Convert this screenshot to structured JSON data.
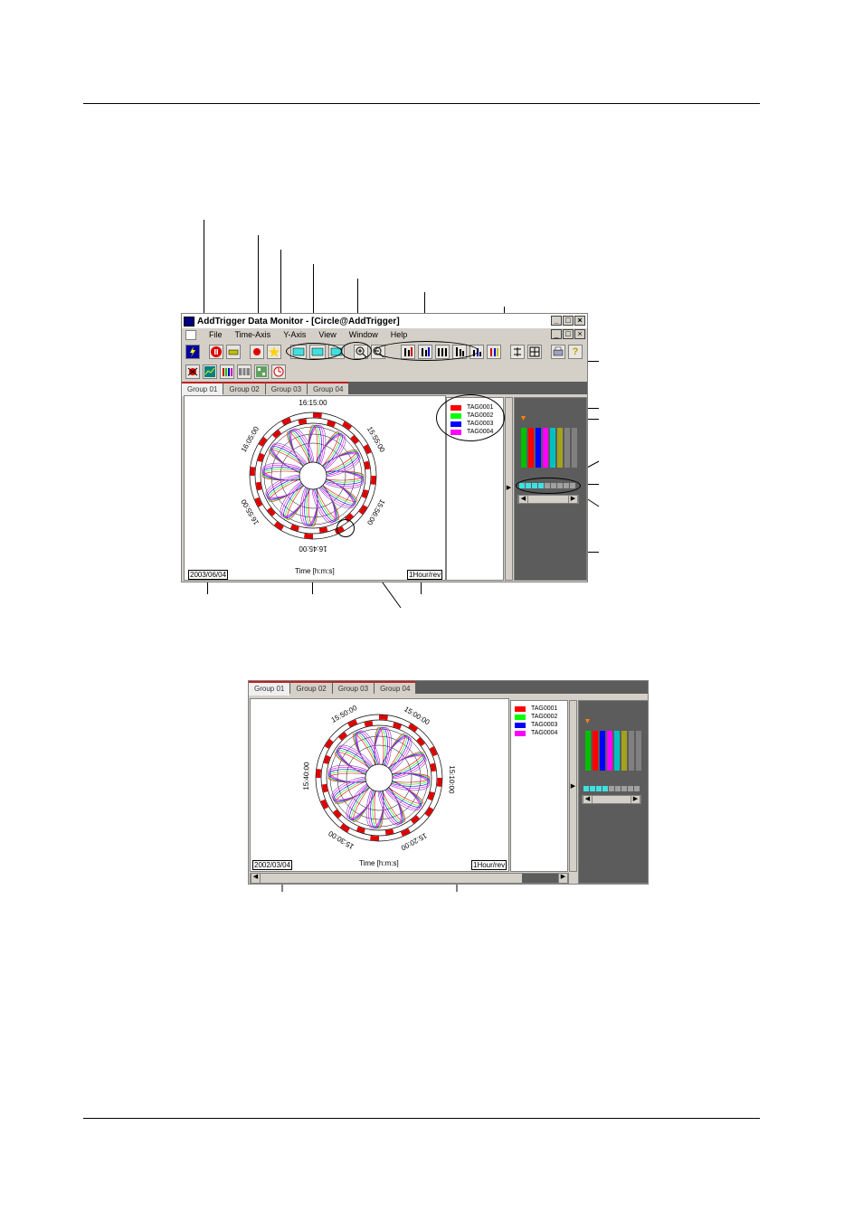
{
  "window": {
    "title": "AddTrigger Data Monitor - [Circle@AddTrigger]",
    "controls": [
      "_",
      "□",
      "×"
    ]
  },
  "menu": [
    "File",
    "Time-Axis",
    "Y-Axis",
    "View",
    "Window",
    "Help"
  ],
  "tabs": [
    "Group 01",
    "Group 02",
    "Group 03",
    "Group 04"
  ],
  "legend": [
    {
      "name": "TAG0001",
      "color": "#ff0000"
    },
    {
      "name": "TAG0002",
      "color": "#00ff00"
    },
    {
      "name": "TAG0003",
      "color": "#0000ff"
    },
    {
      "name": "TAG0004",
      "color": "#ff00ff"
    }
  ],
  "colors": {
    "bar_palette": [
      "#00c000",
      "#ff0000",
      "#0000ff",
      "#ff00ff",
      "#00c0c0",
      "#c0c000",
      "#808080",
      "#8040c0"
    ],
    "ring_segment": "#e00000",
    "cyan": "#40e0e0"
  },
  "upper": {
    "times": [
      "16:15:00",
      "15:55:00",
      "15:56:00",
      "16:45:00",
      "16:55:00",
      "16:05:00"
    ],
    "date": "2003/06/04",
    "time_axis_label": "Time [h:m:s]",
    "rate": "1Hour/rev"
  },
  "lower": {
    "times": [
      "15:50:00",
      "15:00:00",
      "15:10:00",
      "15:20:00",
      "15:30:00",
      "15:40:00"
    ],
    "date": "2002/03/04",
    "time_axis_label": "Time [h:m:s]",
    "rate": "1Hour/rev"
  }
}
